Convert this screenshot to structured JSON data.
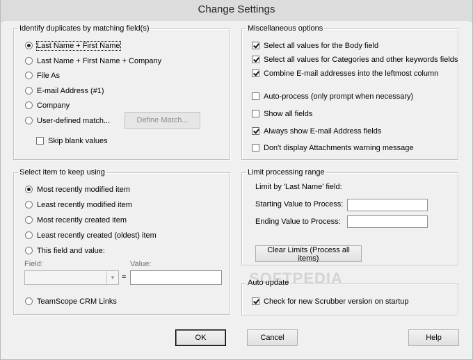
{
  "window": {
    "title": "Change Settings"
  },
  "identify": {
    "legend": "Identify duplicates by matching field(s)",
    "options": [
      "Last Name + First Name",
      "Last Name + First Name + Company",
      "File As",
      "E-mail Address (#1)",
      "Company",
      "User-defined match..."
    ],
    "selected_index": 0,
    "define_match_label": "Define Match...",
    "skip_blank_label": "Skip blank values",
    "skip_blank_checked": false
  },
  "misc": {
    "legend": "Miscellaneous options",
    "items": [
      {
        "label": "Select all values for the Body field",
        "checked": true
      },
      {
        "label": "Select all values for Categories and other keywords fields",
        "checked": true
      },
      {
        "label": "Combine E-mail addresses into the leftmost column",
        "checked": true
      },
      {
        "label": "Auto-process (only prompt when necessary)",
        "checked": false
      },
      {
        "label": "Show all fields",
        "checked": false
      },
      {
        "label": "Always show E-mail Address fields",
        "checked": true
      },
      {
        "label": "Don't display Attachments warning message",
        "checked": false
      }
    ]
  },
  "keep": {
    "legend": "Select item to keep using",
    "options": [
      "Most recently modified item",
      "Least recently modified item",
      "Most recently created item",
      "Least recently created (oldest) item",
      "This field and value:"
    ],
    "selected_index": 0,
    "field_label": "Field:",
    "value_label": "Value:",
    "equals": "=",
    "field_value": "",
    "value_value": "",
    "teamscope_label": "TeamScope CRM Links"
  },
  "limit": {
    "legend": "Limit processing range",
    "limit_by": "Limit by 'Last Name' field:",
    "start_label": "Starting Value to Process:",
    "end_label": "Ending Value to Process:",
    "start_value": "",
    "end_value": "",
    "clear_label": "Clear Limits (Process all items)",
    "watermark": "SOFTPEDIA"
  },
  "auto_update": {
    "legend": "Auto update",
    "check_label": "Check for new Scrubber version on startup",
    "checked": true
  },
  "buttons": {
    "ok": "OK",
    "cancel": "Cancel",
    "help": "Help"
  }
}
